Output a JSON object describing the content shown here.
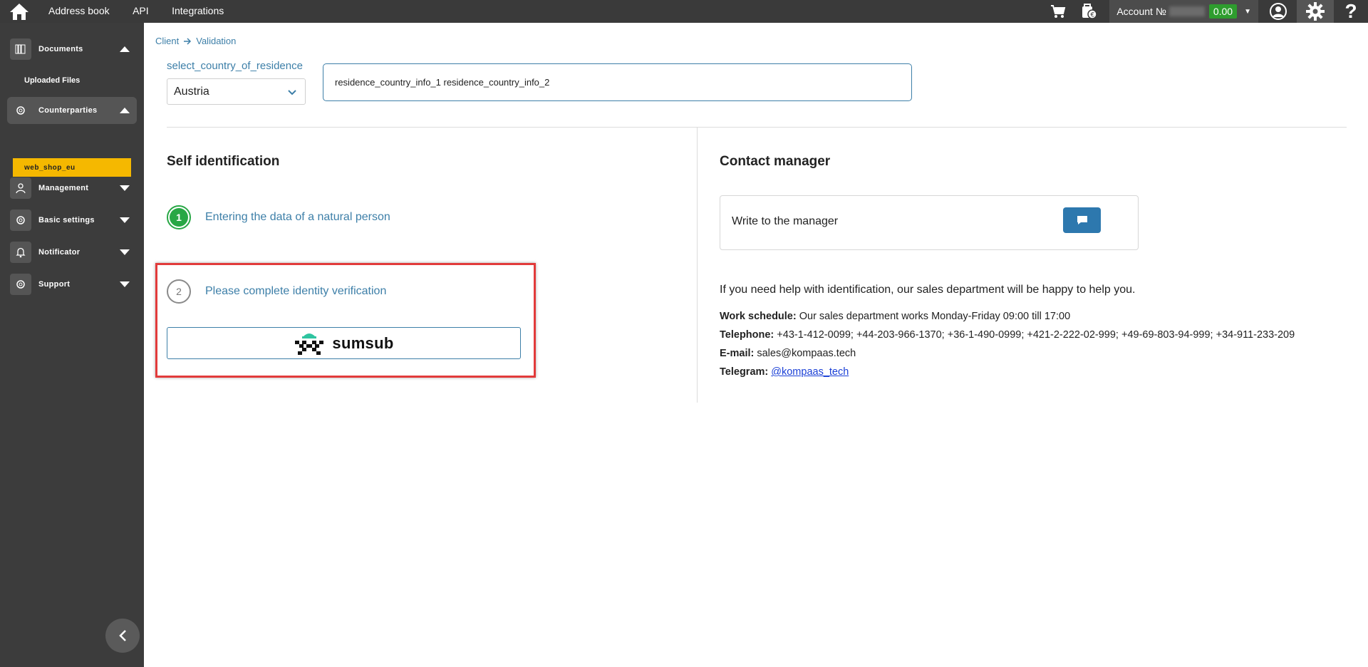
{
  "topbar": {
    "nav": [
      "Address book",
      "API",
      "Integrations"
    ],
    "account_label": "Account №",
    "balance": "0.00"
  },
  "sidebar": {
    "items": [
      {
        "label": "Documents",
        "icon": "documents-icon",
        "expanded": true
      },
      {
        "label": "Counterparties",
        "icon": "gear-icon",
        "expanded": true
      },
      {
        "label": "Management",
        "icon": "user-icon",
        "expanded": false
      },
      {
        "label": "Basic settings",
        "icon": "gear-icon",
        "expanded": false
      },
      {
        "label": "Notificator",
        "icon": "bell-icon",
        "expanded": false
      },
      {
        "label": "Support",
        "icon": "gear-icon",
        "expanded": false
      }
    ],
    "subitems": {
      "uploaded_files": "Uploaded Files",
      "web_shop": "web_shop_eu"
    },
    "highlight_color": "#f5b800"
  },
  "breadcrumb": {
    "client": "Client",
    "validation": "Validation"
  },
  "residence": {
    "label": "select_country_of_residence",
    "selected": "Austria",
    "info": "residence_country_info_1 residence_country_info_2"
  },
  "self_identification": {
    "title": "Self identification",
    "steps": [
      {
        "number": "1",
        "text": "Entering the data of a natural person",
        "status": "done"
      },
      {
        "number": "2",
        "text": "Please complete identity verification",
        "status": "pending"
      }
    ],
    "provider_button": "sumsub"
  },
  "contact": {
    "title": "Contact manager",
    "write_label": "Write to the manager",
    "help_text": "If you need help with identification, our sales department will be happy to help you.",
    "schedule_label": "Work schedule:",
    "schedule_value": " Our sales department works Monday-Friday 09:00 till 17:00",
    "phone_label": "Telephone:",
    "phone_value": " +43-1-412-0099; +44-203-966-1370; +36-1-490-0999; +421-2-222-02-999; +49-69-803-94-999; +34-911-233-209",
    "email_label": "E-mail:",
    "email_value": " sales@kompaas.tech",
    "telegram_label": "Telegram:",
    "telegram_value": "@kompaas_tech"
  },
  "colors": {
    "accent": "#3d7fa8",
    "success": "#28a745",
    "highlight_border": "#e23b3b",
    "button": "#2d78ae"
  }
}
